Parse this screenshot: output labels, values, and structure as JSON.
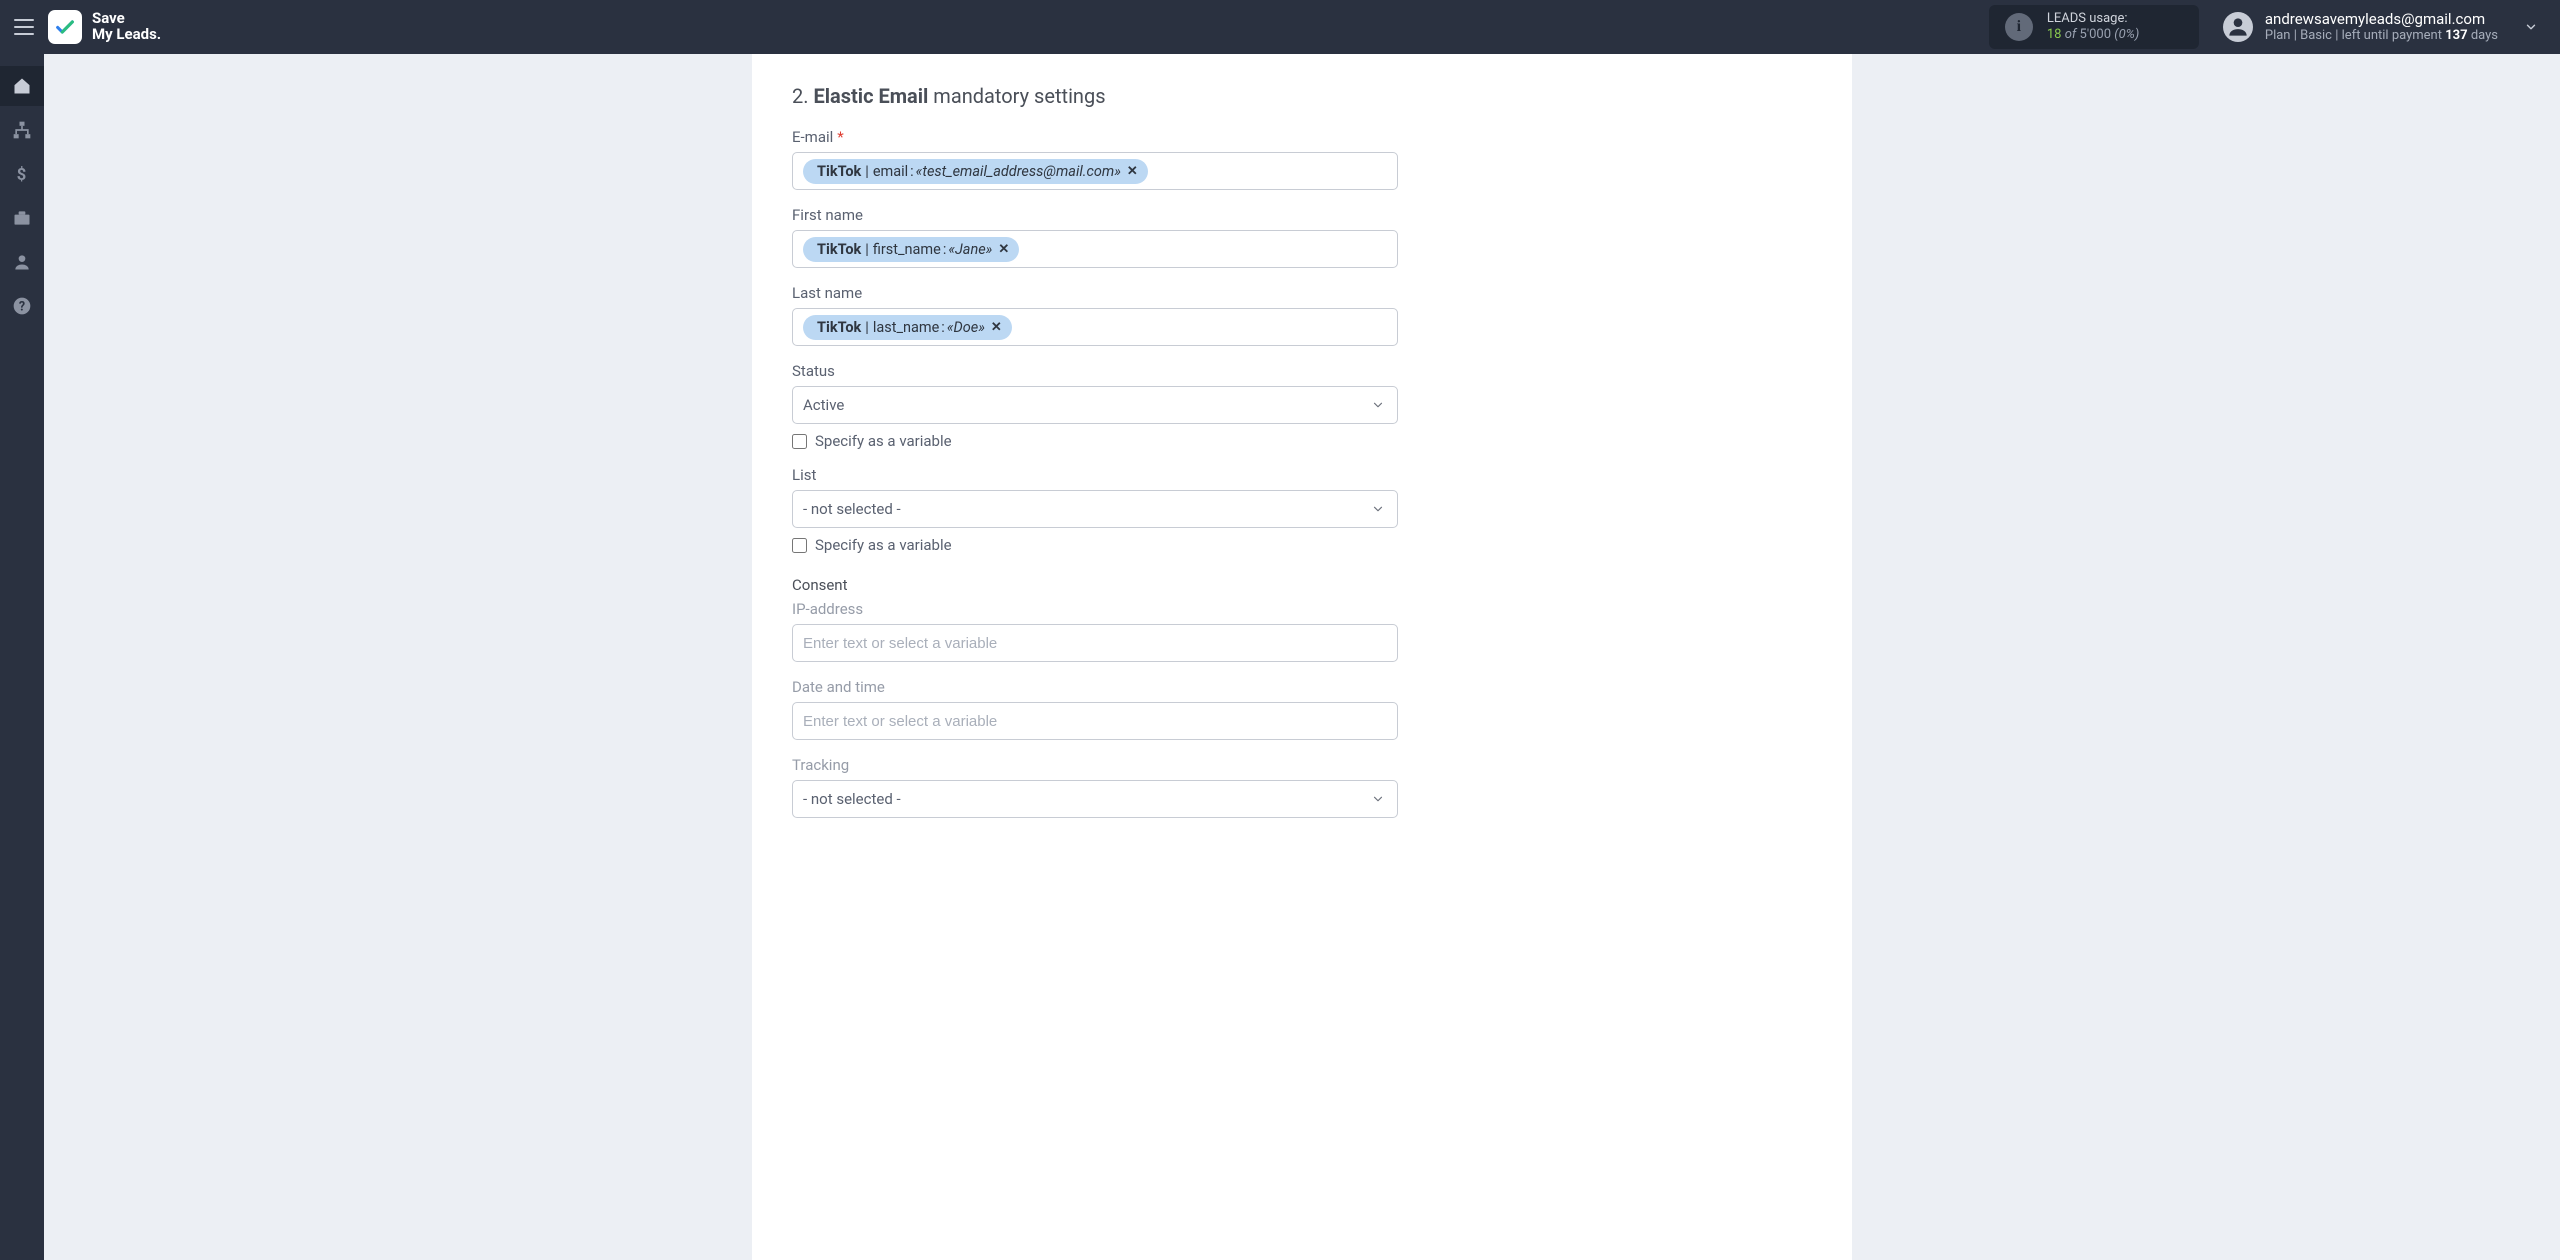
{
  "brand": {
    "line1": "Save",
    "line2": "My Leads."
  },
  "header": {
    "usage_title": "LEADS usage:",
    "usage_used": "18",
    "usage_of": "of",
    "usage_total": "5'000",
    "usage_pct": "(0%)",
    "account_email": "andrewsavemyleads@gmail.com",
    "plan_prefix": "Plan |",
    "plan_name": "Basic",
    "plan_mid": "| left until payment",
    "plan_days": "137",
    "plan_days_suffix": "days"
  },
  "sidebar": {
    "items": [
      {
        "id": "home"
      },
      {
        "id": "connections"
      },
      {
        "id": "billing"
      },
      {
        "id": "workspace"
      },
      {
        "id": "account"
      },
      {
        "id": "help"
      }
    ]
  },
  "section": {
    "step": "2.",
    "service": "Elastic Email",
    "suffix": "mandatory settings"
  },
  "labels": {
    "email": "E-mail",
    "first_name": "First name",
    "last_name": "Last name",
    "status": "Status",
    "list": "List",
    "specify_var": "Specify as a variable",
    "consent": "Consent",
    "ip": "IP-address",
    "datetime": "Date and time",
    "tracking": "Tracking",
    "placeholder_text_var": "Enter text or select a variable",
    "not_selected": "- not selected -"
  },
  "tokens": {
    "email": {
      "source": "TikTok",
      "field": "email",
      "value": "«test_email_address@mail.com»"
    },
    "first_name": {
      "source": "TikTok",
      "field": "first_name",
      "value": "«Jane»"
    },
    "last_name": {
      "source": "TikTok",
      "field": "last_name",
      "value": "«Doe»"
    }
  },
  "values": {
    "status": "Active",
    "status_specify": false,
    "list": "- not selected -",
    "list_specify": false,
    "tracking": "- not selected -"
  }
}
